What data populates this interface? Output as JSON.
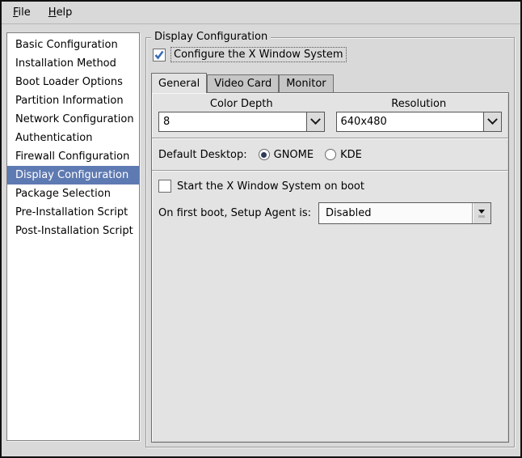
{
  "menubar": {
    "items": [
      {
        "label": "File",
        "accel": "F",
        "rest": "ile"
      },
      {
        "label": "Help",
        "accel": "H",
        "rest": "elp"
      }
    ]
  },
  "sidebar": {
    "items": [
      {
        "label": "Basic Configuration"
      },
      {
        "label": "Installation Method"
      },
      {
        "label": "Boot Loader Options"
      },
      {
        "label": "Partition Information"
      },
      {
        "label": "Network Configuration"
      },
      {
        "label": "Authentication"
      },
      {
        "label": "Firewall Configuration"
      },
      {
        "label": "Display Configuration"
      },
      {
        "label": "Package Selection"
      },
      {
        "label": "Pre-Installation Script"
      },
      {
        "label": "Post-Installation Script"
      }
    ],
    "selected": "Display Configuration"
  },
  "panel": {
    "group_title": "Display Configuration",
    "configure_x": {
      "label": "Configure the X Window System",
      "checked": true
    },
    "tabs": [
      {
        "label": "General",
        "active": true
      },
      {
        "label": "Video Card",
        "active": false
      },
      {
        "label": "Monitor",
        "active": false
      }
    ],
    "general": {
      "color_depth": {
        "label": "Color Depth",
        "value": "8"
      },
      "resolution": {
        "label": "Resolution",
        "value": "640x480"
      },
      "default_desktop": {
        "label": "Default Desktop:",
        "options": [
          {
            "label": "GNOME",
            "selected": true
          },
          {
            "label": "KDE",
            "selected": false
          }
        ]
      },
      "start_x": {
        "label": "Start the X Window System on boot",
        "checked": false
      },
      "setup_agent": {
        "label": "On first boot, Setup Agent is:",
        "value": "Disabled"
      }
    }
  },
  "colors": {
    "window_bg": "#d9d9d9",
    "panel_bg": "#e3e3e3",
    "selection_bg": "#5e7ab2",
    "selection_text": "#ffffff",
    "checkmark": "#3a6cb5",
    "radio_dot": "#2d3b55",
    "inactive_tab": "#c6c6c6",
    "border_dark": "#6e6e6e"
  }
}
